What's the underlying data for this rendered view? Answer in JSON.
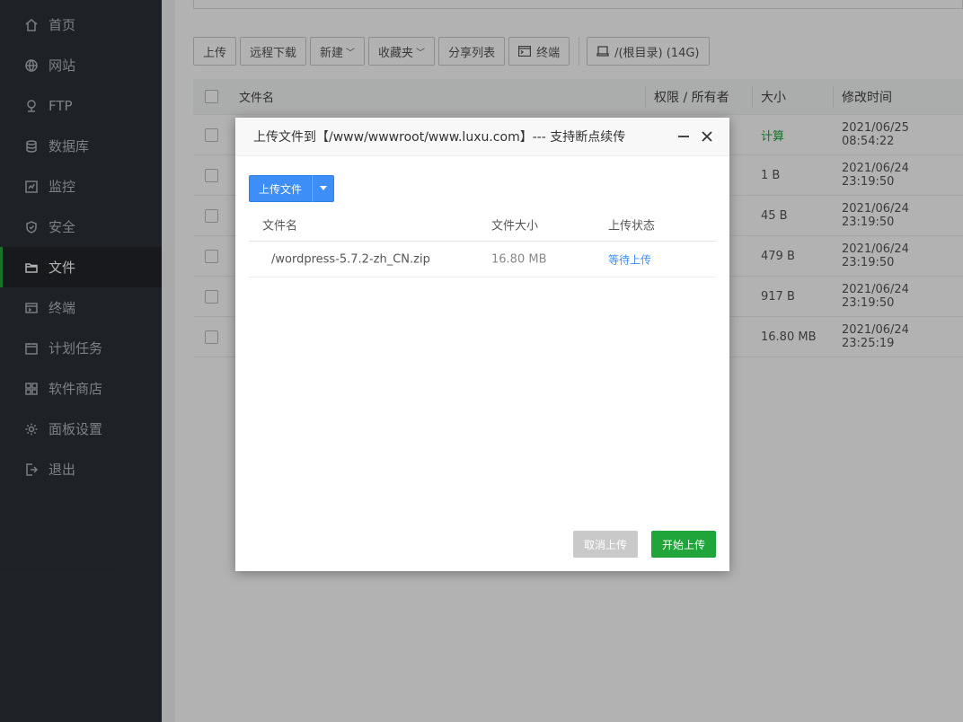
{
  "sidebar": {
    "items": [
      {
        "label": "首页",
        "icon": "home-icon"
      },
      {
        "label": "网站",
        "icon": "globe-icon"
      },
      {
        "label": "FTP",
        "icon": "ftp-icon"
      },
      {
        "label": "数据库",
        "icon": "database-icon"
      },
      {
        "label": "监控",
        "icon": "monitor-icon"
      },
      {
        "label": "安全",
        "icon": "shield-icon"
      },
      {
        "label": "文件",
        "icon": "folder-icon",
        "active": true
      },
      {
        "label": "终端",
        "icon": "terminal-icon"
      },
      {
        "label": "计划任务",
        "icon": "calendar-icon"
      },
      {
        "label": "软件商店",
        "icon": "grid-icon"
      },
      {
        "label": "面板设置",
        "icon": "gear-icon"
      },
      {
        "label": "退出",
        "icon": "logout-icon"
      }
    ]
  },
  "toolbar": {
    "upload": "上传",
    "remote_download": "远程下载",
    "new": "新建",
    "favorites": "收藏夹",
    "share_list": "分享列表",
    "terminal": "终端",
    "root_dir": "/(根目录) (14G)"
  },
  "table": {
    "headers": {
      "name": "文件名",
      "perm": "权限 / 所有者",
      "size": "大小",
      "time": "修改时间"
    },
    "rows": [
      {
        "size": "计算",
        "time": "2021/06/25 08:54:22"
      },
      {
        "size": "1 B",
        "time": "2021/06/24 23:19:50"
      },
      {
        "size": "45 B",
        "time": "2021/06/24 23:19:50"
      },
      {
        "size": "479 B",
        "time": "2021/06/24 23:19:50"
      },
      {
        "size": "917 B",
        "time": "2021/06/24 23:19:50"
      },
      {
        "size": "16.80 MB",
        "time": "2021/06/24 23:25:19"
      }
    ]
  },
  "dialog": {
    "title": "上传文件到【/www/wwwroot/www.luxu.com】--- 支持断点续传",
    "upload_button": "上传文件",
    "headers": {
      "name": "文件名",
      "size": "文件大小",
      "status": "上传状态"
    },
    "files": [
      {
        "name": "/wordpress-5.7.2-zh_CN.zip",
        "size": "16.80 MB",
        "status": "等待上传"
      }
    ],
    "cancel": "取消上传",
    "start": "开始上传"
  },
  "colors": {
    "sidebar_bg": "#2c3138",
    "accent_green": "#20a53a",
    "accent_blue": "#3e8ef7"
  }
}
